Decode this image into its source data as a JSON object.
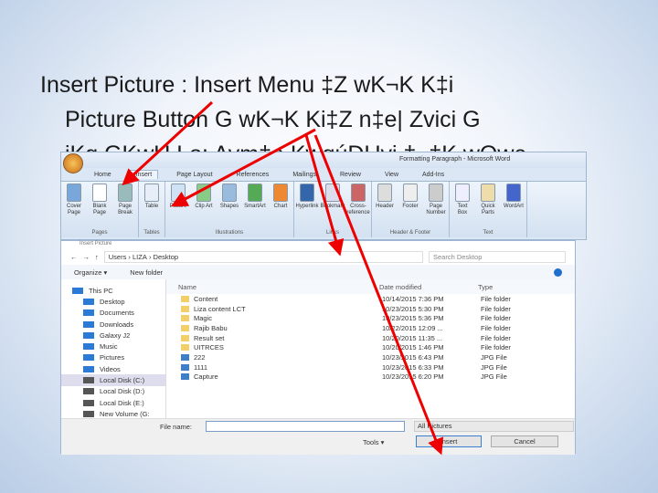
{
  "slide": {
    "lines": [
      "Insert Picture :  Insert Menu  ‡Z wK¬K K‡i",
      "Picture Button G wK¬K Ki‡Z n‡e| Zvici G",
      "iKg GKwU Lo: Avm‡e KwqúDUvi ‡_‡K wQwe"
    ]
  },
  "word": {
    "title": "Formatting Paragraph - Microsoft Word",
    "tabs": [
      "Home",
      "Insert",
      "Page Layout",
      "References",
      "Mailings",
      "Review",
      "View",
      "Add-Ins"
    ],
    "groups": [
      {
        "label": "Pages",
        "buttons": [
          "Cover Page",
          "Blank Page",
          "Page Break"
        ]
      },
      {
        "label": "Tables",
        "buttons": [
          "Table"
        ]
      },
      {
        "label": "Illustrations",
        "buttons": [
          "Picture",
          "Clip Art",
          "Shapes",
          "SmartArt",
          "Chart"
        ]
      },
      {
        "label": "Links",
        "buttons": [
          "Hyperlink",
          "Bookmark",
          "Cross-reference"
        ]
      },
      {
        "label": "Header & Footer",
        "buttons": [
          "Header",
          "Footer",
          "Page Number"
        ]
      },
      {
        "label": "Text",
        "buttons": [
          "Text Box",
          "Quick Parts",
          "WordArt"
        ]
      }
    ]
  },
  "dialog": {
    "title": "Insert Picture",
    "path": [
      "Users",
      "LIZA",
      "Desktop"
    ],
    "search_placeholder": "Search Desktop",
    "organize": "Organize ▾",
    "new_folder": "New folder",
    "nav": [
      "This PC",
      "Desktop",
      "Documents",
      "Downloads",
      "Galaxy J2",
      "Music",
      "Pictures",
      "Videos",
      "Local Disk (C:)",
      "Local Disk (D:)",
      "Local Disk (E:)",
      "New Volume (G:"
    ],
    "columns": [
      "Name",
      "Date modified",
      "Type"
    ],
    "files": [
      {
        "name": "Content",
        "date": "10/14/2015 7:36 PM",
        "type": "File folder",
        "kind": "folder"
      },
      {
        "name": "Liza content LCT",
        "date": "10/23/2015 5:30 PM",
        "type": "File folder",
        "kind": "folder"
      },
      {
        "name": "Magic",
        "date": "10/23/2015 5:36 PM",
        "type": "File folder",
        "kind": "folder"
      },
      {
        "name": "Rajib Babu",
        "date": "10/22/2015 12:09 ...",
        "type": "File folder",
        "kind": "folder"
      },
      {
        "name": "Result set",
        "date": "10/20/2015 11:35 ...",
        "type": "File folder",
        "kind": "folder"
      },
      {
        "name": "UITRCES",
        "date": "10/20/2015 1:46 PM",
        "type": "File folder",
        "kind": "folder"
      },
      {
        "name": "222",
        "date": "10/23/2015 6:43 PM",
        "type": "JPG File",
        "kind": "jpg"
      },
      {
        "name": "1111",
        "date": "10/23/2015 6:33 PM",
        "type": "JPG File",
        "kind": "jpg"
      },
      {
        "name": "Capture",
        "date": "10/23/2015 6:20 PM",
        "type": "JPG File",
        "kind": "jpg"
      }
    ],
    "file_name_label": "File name:",
    "file_name_value": "",
    "filter": "All Pictures",
    "tools": "Tools ▾",
    "insert": "Insert",
    "cancel": "Cancel"
  }
}
